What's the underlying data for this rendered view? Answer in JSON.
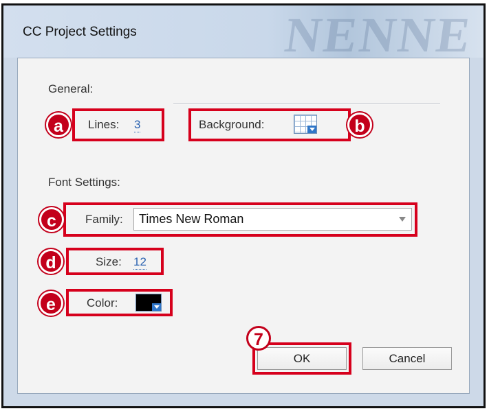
{
  "dialog": {
    "title": "CC Project Settings",
    "watermark": "NENNE"
  },
  "general": {
    "heading": "General:",
    "lines_label": "Lines:",
    "lines_value": "3",
    "background_label": "Background:"
  },
  "font_settings": {
    "heading": "Font Settings:",
    "family_label": "Family:",
    "family_value": "Times New Roman",
    "size_label": "Size:",
    "size_value": "12",
    "color_label": "Color:",
    "color_value": "#000000"
  },
  "buttons": {
    "ok": "OK",
    "cancel": "Cancel"
  },
  "callouts": {
    "a": "a",
    "b": "b",
    "c": "c",
    "d": "d",
    "e": "e",
    "step": "7"
  },
  "colors": {
    "callout_red": "#d6001c",
    "link_blue": "#2a62b0"
  }
}
